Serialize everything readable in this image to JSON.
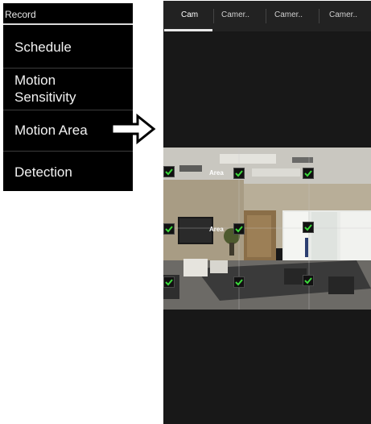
{
  "menu": {
    "header": "Record",
    "items": [
      {
        "label": "Schedule"
      },
      {
        "label_line1": "Motion",
        "label_line2": "Sensitivity"
      },
      {
        "label": "Motion Area"
      },
      {
        "label": "Detection"
      }
    ]
  },
  "camera_tabs": [
    "Cam",
    "Camer..",
    "Camer..",
    "Camer.."
  ],
  "active_tab_index": 0,
  "areas": [
    "Area",
    "Area"
  ],
  "colors": {
    "menu_bg": "#000000",
    "screen_bg": "#181818",
    "mark_green": "#3cd93c"
  },
  "icons": [
    "right-arrow-icon",
    "checkmark-icon"
  ]
}
